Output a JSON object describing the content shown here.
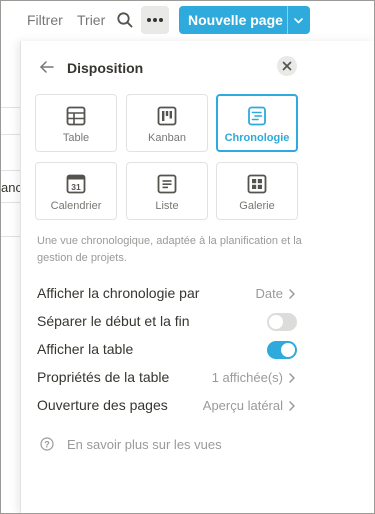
{
  "toolbar": {
    "filter_label": "Filtrer",
    "sort_label": "Trier",
    "search_icon": "search-icon",
    "more_icon": "more-dots-icon",
    "new_page_label": "Nouvelle page",
    "new_page_dropdown_icon": "chevron-down-icon",
    "accent_color": "#2eaadc"
  },
  "background": {
    "partial_text": "anc"
  },
  "panel": {
    "back_icon": "arrow-left-icon",
    "title": "Disposition",
    "close_icon": "close-icon",
    "layouts": [
      {
        "label": "Table",
        "icon": "table-icon",
        "selected": false
      },
      {
        "label": "Kanban",
        "icon": "kanban-icon",
        "selected": false
      },
      {
        "label": "Chronologie",
        "icon": "timeline-icon",
        "selected": true
      },
      {
        "label": "Calendrier",
        "icon": "calendar-icon",
        "icon_text": "31",
        "selected": false
      },
      {
        "label": "Liste",
        "icon": "list-icon",
        "selected": false
      },
      {
        "label": "Galerie",
        "icon": "gallery-icon",
        "selected": false
      }
    ],
    "description": "Une vue chronologique, adaptée à la planification et la gestion de projets.",
    "settings": [
      {
        "label": "Afficher la chronologie par",
        "value": "Date",
        "type": "select"
      },
      {
        "label": "Séparer le début et la fin",
        "type": "toggle",
        "on": false
      },
      {
        "label": "Afficher la table",
        "type": "toggle",
        "on": true
      },
      {
        "label": "Propriétés de la table",
        "value": "1 affichée(s)",
        "type": "select"
      },
      {
        "label": "Ouverture des pages",
        "value": "Aperçu latéral",
        "type": "select"
      }
    ],
    "help": {
      "icon": "help-circle-icon",
      "label": "En savoir plus sur les vues"
    }
  }
}
